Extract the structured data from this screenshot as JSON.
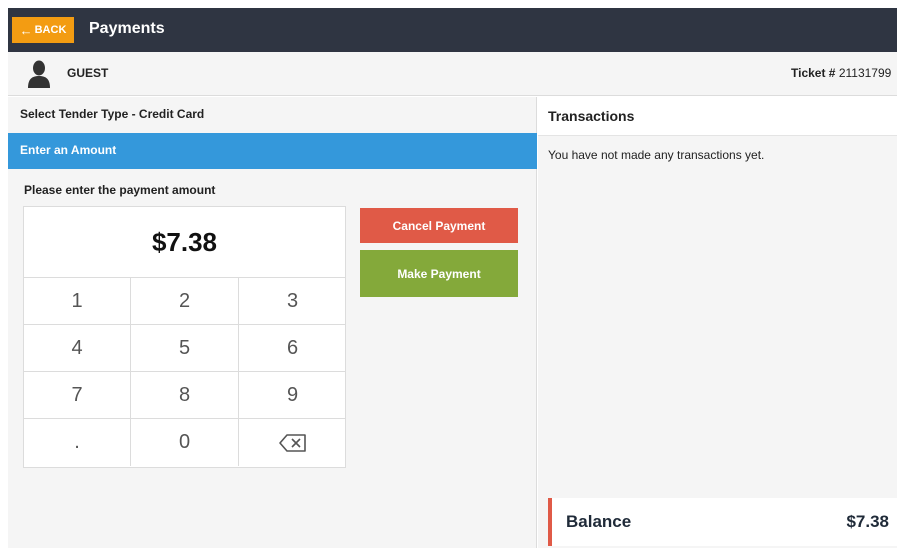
{
  "header": {
    "back_label": "BACK",
    "back_arrow": "←",
    "title": "Payments"
  },
  "customer": {
    "name": "GUEST",
    "ticket_label": "Ticket #",
    "ticket_number": "21131799"
  },
  "tender": {
    "label": "Select Tender Type - Credit Card",
    "amount_section": "Enter an Amount",
    "prompt": "Please enter the payment amount",
    "amount": "$7.38"
  },
  "keypad": {
    "keys": [
      "1",
      "2",
      "3",
      "4",
      "5",
      "6",
      "7",
      "8",
      "9",
      ".",
      "0"
    ]
  },
  "actions": {
    "cancel_label": "Cancel Payment",
    "make_label": "Make Payment"
  },
  "transactions": {
    "title": "Transactions",
    "empty_message": "You have not made any transactions yet."
  },
  "balance": {
    "label": "Balance",
    "value": "$7.38"
  },
  "colors": {
    "topbar": "#2f3542",
    "back_button": "#f39c12",
    "section_header": "#3498db",
    "cancel": "#e05a47",
    "make_payment": "#84a93a",
    "balance_accent": "#e05a47"
  },
  "icons": {
    "back": "arrow-left-icon",
    "avatar": "user-silhouette-icon",
    "backspace": "backspace-icon"
  }
}
